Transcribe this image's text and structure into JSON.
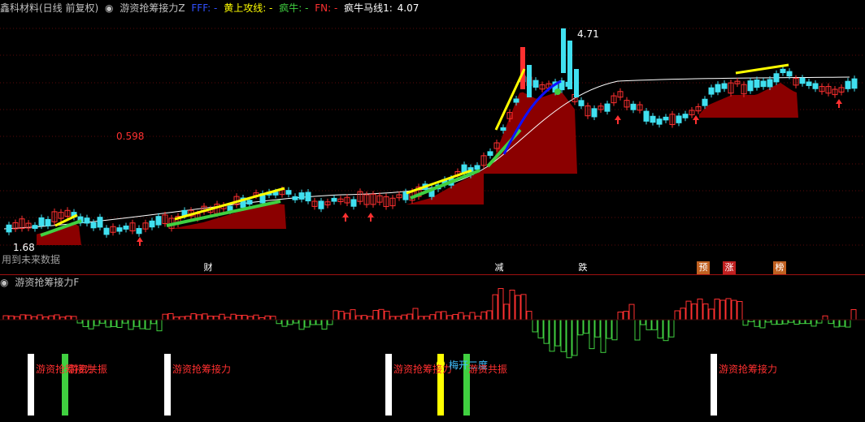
{
  "main_header": {
    "symbol_label": "鑫科材料(日线 前复权)",
    "collapse_icon": "circle-arrow-icon",
    "indicator_name": "游资抢筹接力Z",
    "fff_label": "FFF: -",
    "huang_label": "黄上攻线: -",
    "fengniu_label": "疯牛: -",
    "fn_label": "FN: -",
    "fengniu_ma_label": "疯牛马线1:",
    "fengniu_ma_value": "4.07"
  },
  "price_labels": {
    "high": "4.71",
    "mid": "0.598",
    "low": "1.68",
    "future_note": "用到未来数据"
  },
  "event_markers": [
    {
      "text": "财",
      "color": "#ffffff",
      "bg": "#000000"
    },
    {
      "text": "减",
      "color": "#ffffff",
      "bg": "#000000"
    },
    {
      "text": "跌",
      "color": "#ffffff",
      "bg": "#000000"
    },
    {
      "text": "预",
      "color": "#ffffff",
      "bg": "#c06020"
    },
    {
      "text": "涨",
      "color": "#ffffff",
      "bg": "#c02020"
    },
    {
      "text": "榜",
      "color": "#ffffff",
      "bg": "#c06020"
    }
  ],
  "sub_header": {
    "collapse_icon": "circle-arrow-icon",
    "indicator_name": "游资抢筹接力F"
  },
  "signal_labels": [
    {
      "text": "游资抢筹接力",
      "color": "#ff3030"
    },
    {
      "text": "游资共振",
      "color": "#ff3030"
    },
    {
      "text": "游资抢筹接力",
      "color": "#ff3030"
    },
    {
      "text": "游资抢筹接力",
      "color": "#ff3030"
    },
    {
      "text": "梅开二度",
      "color": "#40c0ff"
    },
    {
      "text": "游资共振",
      "color": "#ff3030"
    },
    {
      "text": "游资抢筹接力",
      "color": "#ff3030"
    }
  ],
  "colors": {
    "up": "#ff3030",
    "down": "#40e0f0",
    "fill": "#8b0000",
    "yellow": "#ffff00",
    "green": "#40d040",
    "blue": "#1010ff"
  }
}
